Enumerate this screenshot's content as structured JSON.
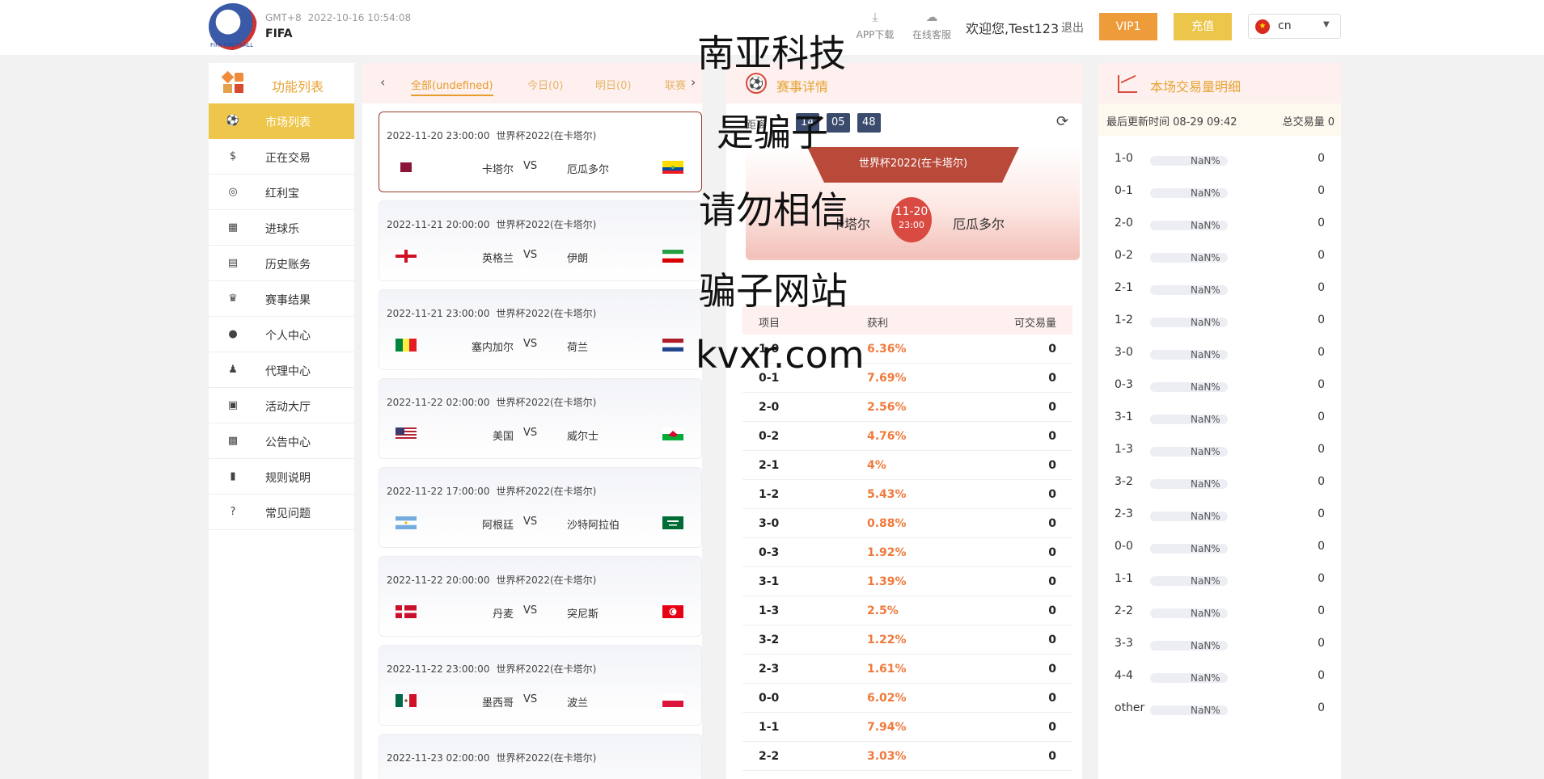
{
  "header": {
    "logo_text": "FIFA FOOTBALL",
    "timezone": "GMT+8",
    "datetime": "2022-10-16 10:54:08",
    "brand": "FIFA",
    "app_download": "APP下载",
    "online_service": "在线客服",
    "welcome": "欢迎您,Test123",
    "logout": "退出",
    "vip": "VIP1",
    "recharge": "充值",
    "lang": "cn"
  },
  "sidebar": {
    "title": "功能列表",
    "items": [
      {
        "label": "市场列表",
        "icon": "soccer-ball-icon"
      },
      {
        "label": "正在交易",
        "icon": "money-bag-icon"
      },
      {
        "label": "红利宝",
        "icon": "coins-icon"
      },
      {
        "label": "进球乐",
        "icon": "goal-net-icon"
      },
      {
        "label": "历史账务",
        "icon": "ledger-icon"
      },
      {
        "label": "赛事结果",
        "icon": "trophy-icon"
      },
      {
        "label": "个人中心",
        "icon": "user-icon"
      },
      {
        "label": "代理中心",
        "icon": "org-chart-icon"
      },
      {
        "label": "活动大厅",
        "icon": "gift-icon"
      },
      {
        "label": "公告中心",
        "icon": "calendar-icon"
      },
      {
        "label": "规则说明",
        "icon": "document-icon"
      },
      {
        "label": "常见问题",
        "icon": "question-icon"
      }
    ]
  },
  "match_tabs": [
    "全部(undefined)",
    "今日(0)",
    "明日(0)",
    "联赛"
  ],
  "matches": [
    {
      "time": "2022-11-20 23:00:00",
      "league": "世界杯2022(在卡塔尔)",
      "home": "卡塔尔",
      "away": "厄瓜多尔",
      "vs": "VS"
    },
    {
      "time": "2022-11-21 20:00:00",
      "league": "世界杯2022(在卡塔尔)",
      "home": "英格兰",
      "away": "伊朗",
      "vs": "VS"
    },
    {
      "time": "2022-11-21 23:00:00",
      "league": "世界杯2022(在卡塔尔)",
      "home": "塞内加尔",
      "away": "荷兰",
      "vs": "VS"
    },
    {
      "time": "2022-11-22 02:00:00",
      "league": "世界杯2022(在卡塔尔)",
      "home": "美国",
      "away": "威尔士",
      "vs": "VS"
    },
    {
      "time": "2022-11-22 17:00:00",
      "league": "世界杯2022(在卡塔尔)",
      "home": "阿根廷",
      "away": "沙特阿拉伯",
      "vs": "VS"
    },
    {
      "time": "2022-11-22 20:00:00",
      "league": "世界杯2022(在卡塔尔)",
      "home": "丹麦",
      "away": "突尼斯",
      "vs": "VS"
    },
    {
      "time": "2022-11-22 23:00:00",
      "league": "世界杯2022(在卡塔尔)",
      "home": "墨西哥",
      "away": "波兰",
      "vs": "VS"
    },
    {
      "time": "2022-11-23 02:00:00",
      "league": "世界杯2022(在卡塔尔)",
      "home": "",
      "away": "",
      "vs": ""
    }
  ],
  "detail": {
    "title": "赛事详情",
    "countdown_label": "距离",
    "countdown": [
      "14",
      "05",
      "48"
    ],
    "league": "世界杯2022(在卡塔尔)",
    "home": "卡塔尔",
    "away": "厄瓜多尔",
    "date": "11-20",
    "time": "23:00",
    "columns": [
      "项目",
      "获利",
      "可交易量"
    ],
    "rows": [
      {
        "item": "1-0",
        "profit": "6.36%",
        "vol": "0"
      },
      {
        "item": "0-1",
        "profit": "7.69%",
        "vol": "0"
      },
      {
        "item": "2-0",
        "profit": "2.56%",
        "vol": "0"
      },
      {
        "item": "0-2",
        "profit": "4.76%",
        "vol": "0"
      },
      {
        "item": "2-1",
        "profit": "4%",
        "vol": "0"
      },
      {
        "item": "1-2",
        "profit": "5.43%",
        "vol": "0"
      },
      {
        "item": "3-0",
        "profit": "0.88%",
        "vol": "0"
      },
      {
        "item": "0-3",
        "profit": "1.92%",
        "vol": "0"
      },
      {
        "item": "3-1",
        "profit": "1.39%",
        "vol": "0"
      },
      {
        "item": "1-3",
        "profit": "2.5%",
        "vol": "0"
      },
      {
        "item": "3-2",
        "profit": "1.22%",
        "vol": "0"
      },
      {
        "item": "2-3",
        "profit": "1.61%",
        "vol": "0"
      },
      {
        "item": "0-0",
        "profit": "6.02%",
        "vol": "0"
      },
      {
        "item": "1-1",
        "profit": "7.94%",
        "vol": "0"
      },
      {
        "item": "2-2",
        "profit": "3.03%",
        "vol": "0"
      }
    ]
  },
  "volume": {
    "title": "本场交易量明细",
    "updated": "最后更新时间 08-29 09:42",
    "total": "总交易量 0",
    "rows": [
      {
        "label": "1-0",
        "pct": "NaN%",
        "val": "0"
      },
      {
        "label": "0-1",
        "pct": "NaN%",
        "val": "0"
      },
      {
        "label": "2-0",
        "pct": "NaN%",
        "val": "0"
      },
      {
        "label": "0-2",
        "pct": "NaN%",
        "val": "0"
      },
      {
        "label": "2-1",
        "pct": "NaN%",
        "val": "0"
      },
      {
        "label": "1-2",
        "pct": "NaN%",
        "val": "0"
      },
      {
        "label": "3-0",
        "pct": "NaN%",
        "val": "0"
      },
      {
        "label": "0-3",
        "pct": "NaN%",
        "val": "0"
      },
      {
        "label": "3-1",
        "pct": "NaN%",
        "val": "0"
      },
      {
        "label": "1-3",
        "pct": "NaN%",
        "val": "0"
      },
      {
        "label": "3-2",
        "pct": "NaN%",
        "val": "0"
      },
      {
        "label": "2-3",
        "pct": "NaN%",
        "val": "0"
      },
      {
        "label": "0-0",
        "pct": "NaN%",
        "val": "0"
      },
      {
        "label": "1-1",
        "pct": "NaN%",
        "val": "0"
      },
      {
        "label": "2-2",
        "pct": "NaN%",
        "val": "0"
      },
      {
        "label": "3-3",
        "pct": "NaN%",
        "val": "0"
      },
      {
        "label": "4-4",
        "pct": "NaN%",
        "val": "0"
      },
      {
        "label": "other",
        "pct": "NaN%",
        "val": "0"
      }
    ]
  },
  "watermark": [
    "南亚科技",
    "是骗子",
    "请勿相信",
    "骗子网站",
    "kvxr.com"
  ]
}
